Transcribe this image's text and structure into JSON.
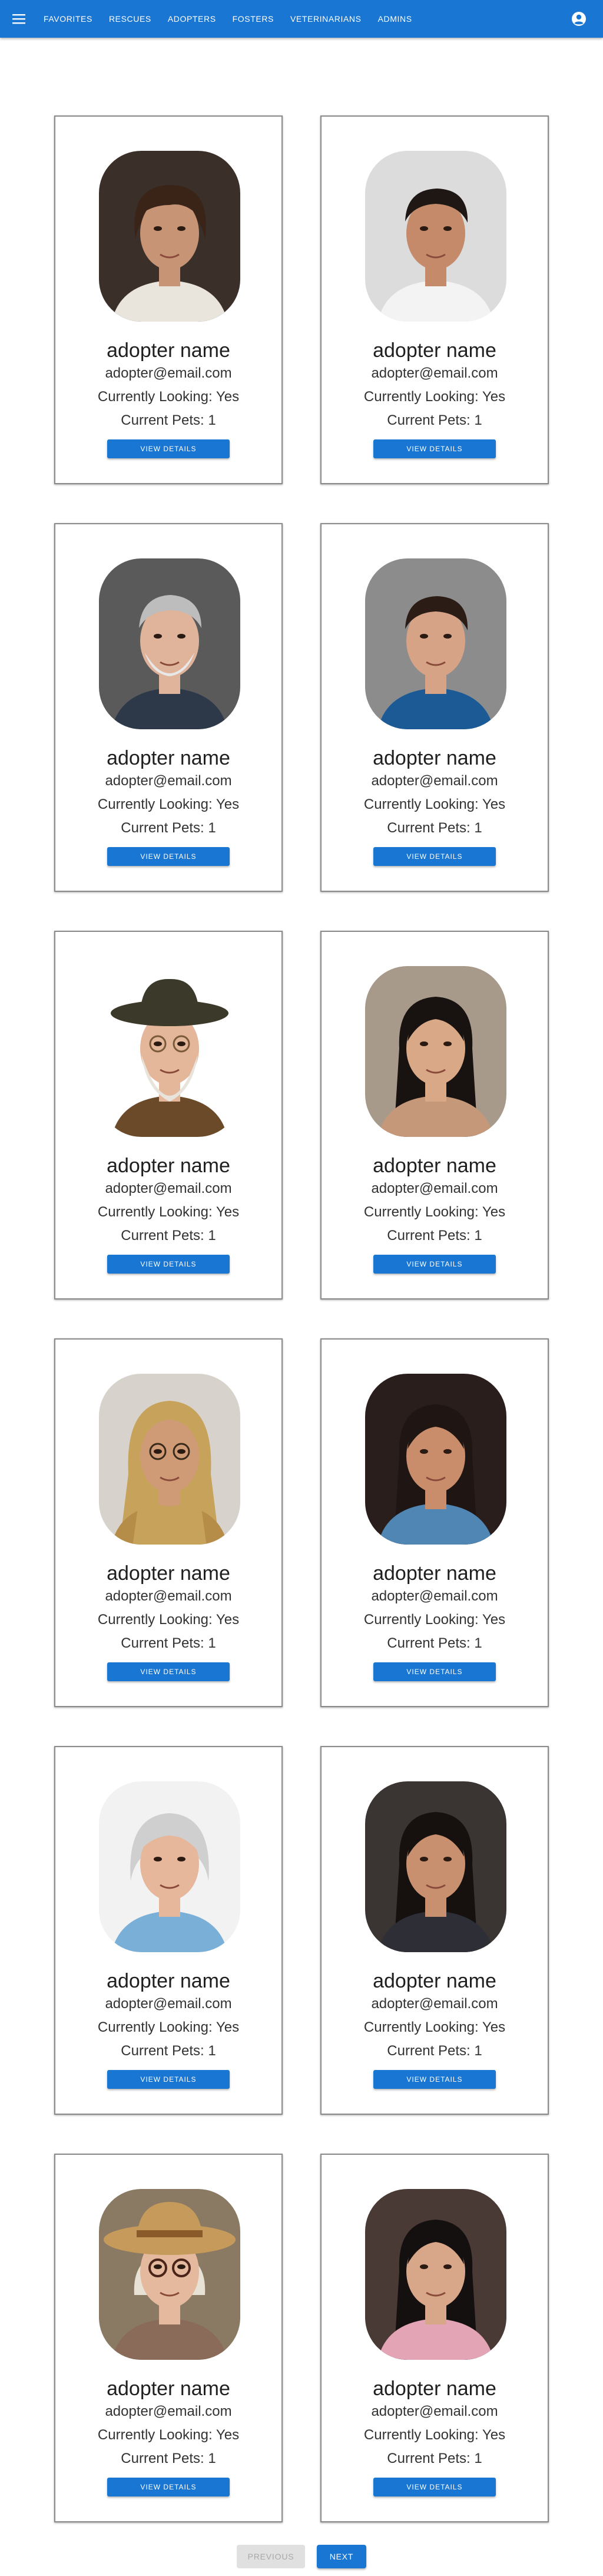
{
  "appbar": {
    "menu_icon": "hamburger-menu-icon",
    "nav": [
      "FAVORITES",
      "RESCUES",
      "ADOPTERS",
      "FOSTERS",
      "VETERINARIANS",
      "ADMINS"
    ],
    "account_icon": "account-circle-icon",
    "color": "#1976d2"
  },
  "cards": [
    {
      "name": "adopter name",
      "email": "adopter@email.com",
      "looking": "Currently Looking: Yes",
      "pets": "Current Pets: 1",
      "button": "VIEW DETAILS",
      "photo": "young-man-wavy-hair"
    },
    {
      "name": "adopter name",
      "email": "adopter@email.com",
      "looking": "Currently Looking: Yes",
      "pets": "Current Pets: 1",
      "button": "VIEW DETAILS",
      "photo": "young-man-dark-hair"
    },
    {
      "name": "adopter name",
      "email": "adopter@email.com",
      "looking": "Currently Looking: Yes",
      "pets": "Current Pets: 1",
      "button": "VIEW DETAILS",
      "photo": "older-man-gray-beard"
    },
    {
      "name": "adopter name",
      "email": "adopter@email.com",
      "looking": "Currently Looking: Yes",
      "pets": "Current Pets: 1",
      "button": "VIEW DETAILS",
      "photo": "man-dark-hair-blue-shirt"
    },
    {
      "name": "adopter name",
      "email": "adopter@email.com",
      "looking": "Currently Looking: Yes",
      "pets": "Current Pets: 1",
      "button": "VIEW DETAILS",
      "photo": "elderly-man-hat-beard"
    },
    {
      "name": "adopter name",
      "email": "adopter@email.com",
      "looking": "Currently Looking: Yes",
      "pets": "Current Pets: 1",
      "button": "VIEW DETAILS",
      "photo": "young-woman-long-black-hair"
    },
    {
      "name": "adopter name",
      "email": "adopter@email.com",
      "looking": "Currently Looking: Yes",
      "pets": "Current Pets: 1",
      "button": "VIEW DETAILS",
      "photo": "woman-headscarf-glasses"
    },
    {
      "name": "adopter name",
      "email": "adopter@email.com",
      "looking": "Currently Looking: Yes",
      "pets": "Current Pets: 1",
      "button": "VIEW DETAILS",
      "photo": "young-woman-dark-hair"
    },
    {
      "name": "adopter name",
      "email": "adopter@email.com",
      "looking": "Currently Looking: Yes",
      "pets": "Current Pets: 1",
      "button": "VIEW DETAILS",
      "photo": "older-woman-silver-hair"
    },
    {
      "name": "adopter name",
      "email": "adopter@email.com",
      "looking": "Currently Looking: Yes",
      "pets": "Current Pets: 1",
      "button": "VIEW DETAILS",
      "photo": "woman-long-dark-hair"
    },
    {
      "name": "adopter name",
      "email": "adopter@email.com",
      "looking": "Currently Looking: Yes",
      "pets": "Current Pets: 1",
      "button": "VIEW DETAILS",
      "photo": "older-woman-straw-hat-glasses"
    },
    {
      "name": "adopter name",
      "email": "adopter@email.com",
      "looking": "Currently Looking: Yes",
      "pets": "Current Pets: 1",
      "button": "VIEW DETAILS",
      "photo": "young-woman-smiling"
    }
  ],
  "pagination": {
    "previous": "PREVIOUS",
    "next": "NEXT"
  }
}
